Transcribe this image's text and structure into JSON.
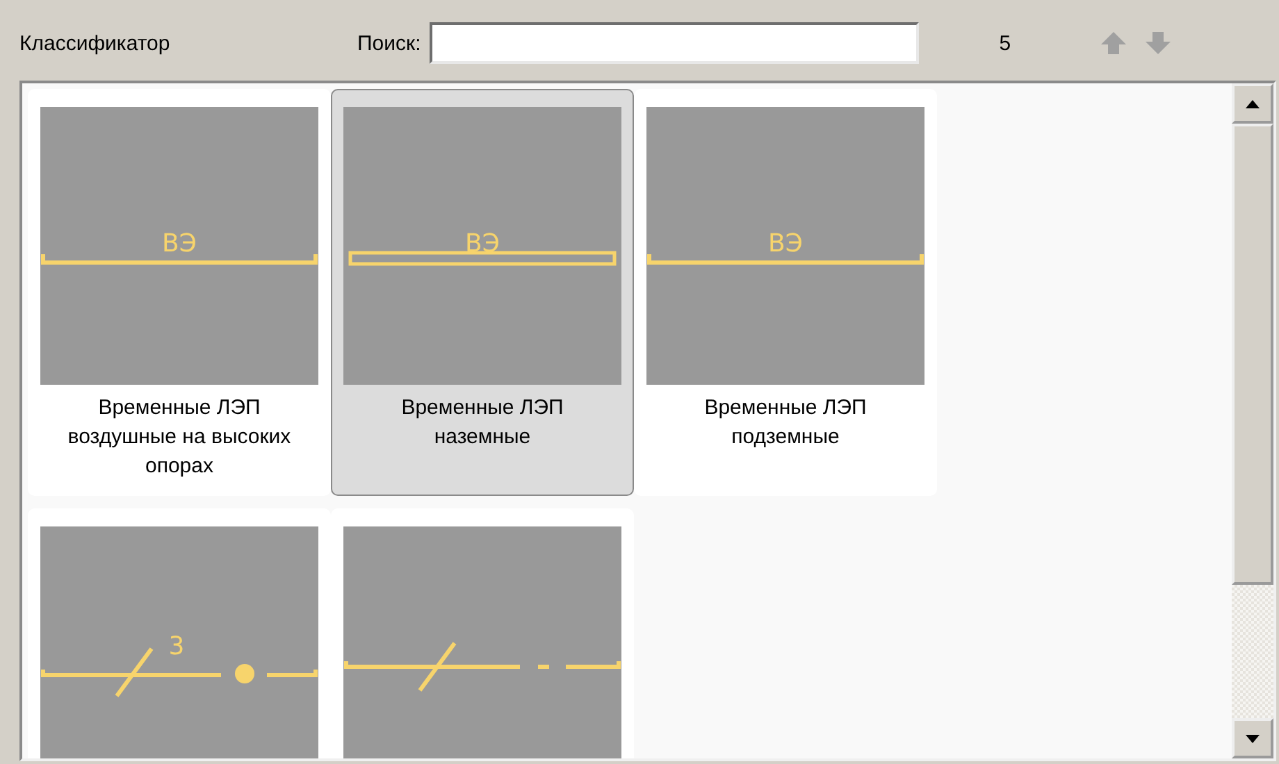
{
  "toolbar": {
    "title": "Классификатор",
    "search": {
      "label": "Поиск:"
    },
    "count": "5"
  },
  "tiles": [
    {
      "kind": "line-label",
      "symbol_text": "ВЭ",
      "caption": "Временные ЛЭП воздушные на высоких опорах",
      "selected": false
    },
    {
      "kind": "double-line-label",
      "symbol_text": "ВЭ",
      "caption": "Временные ЛЭП наземные",
      "selected": true
    },
    {
      "kind": "line-label",
      "symbol_text": "ВЭ",
      "caption": "Временные ЛЭП подземные",
      "selected": false
    },
    {
      "kind": "slash-dot",
      "symbol_text": "3",
      "selected": false
    },
    {
      "kind": "slash-dash",
      "selected": false
    }
  ]
}
